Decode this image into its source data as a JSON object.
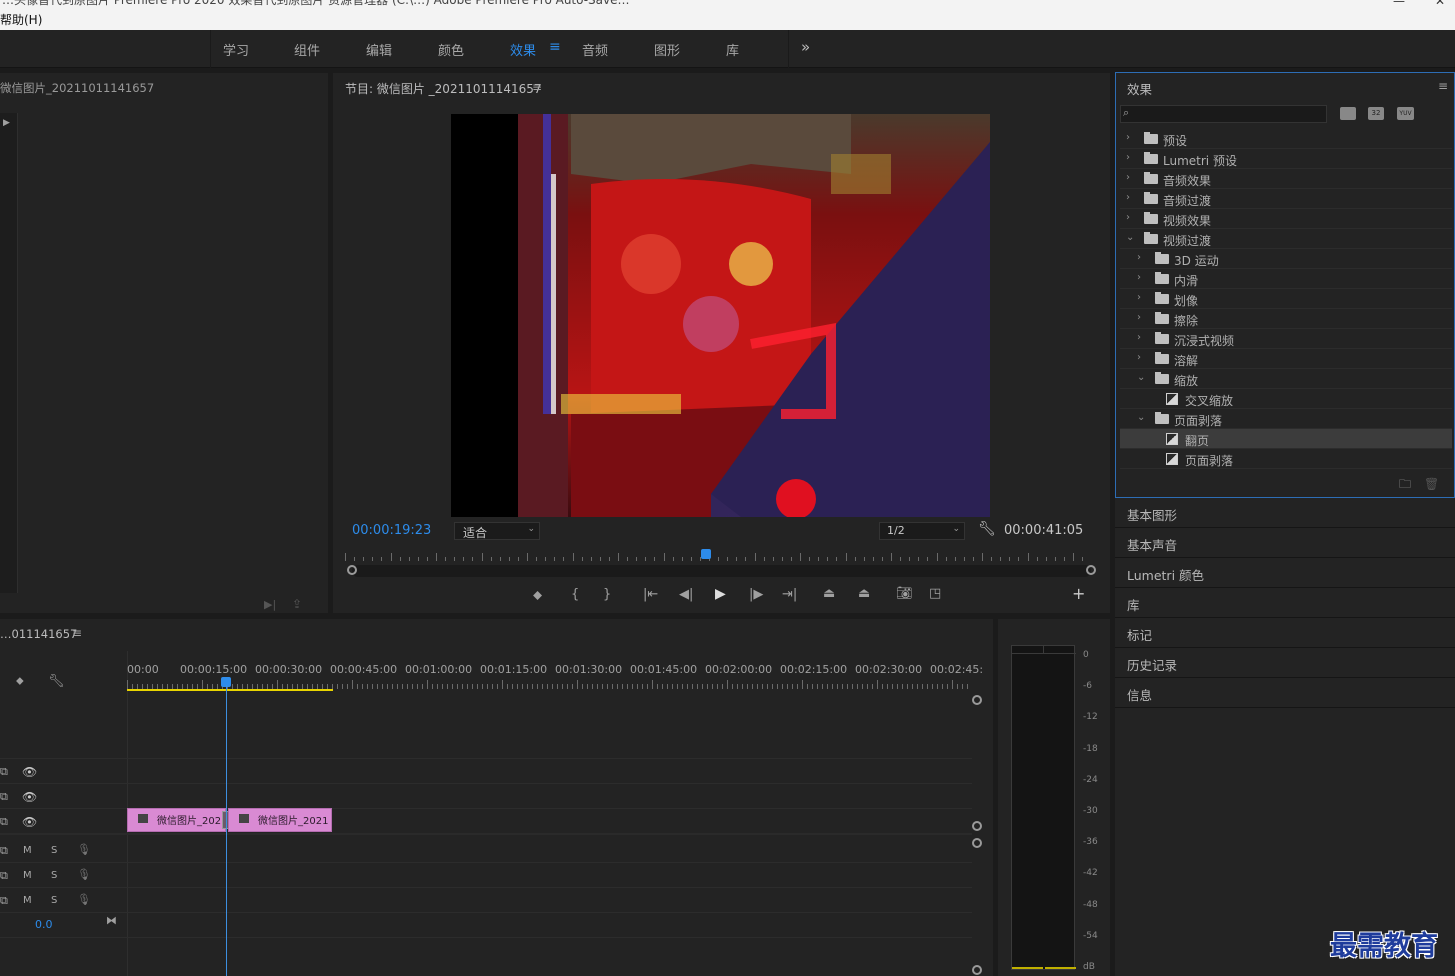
{
  "window": {
    "title": "…头像替代到原图片 Premiere Pro 2020 效果替代到原图片 资源管理器 (C:\\…) Adobe Premiere Pro Auto-Save…",
    "menu_help": "帮助(H)"
  },
  "workspaces": [
    {
      "label": "学习"
    },
    {
      "label": "组件"
    },
    {
      "label": "编辑"
    },
    {
      "label": "颜色"
    },
    {
      "label": "效果",
      "active": true
    },
    {
      "label": "音频"
    },
    {
      "label": "图形"
    },
    {
      "label": "库"
    }
  ],
  "source": {
    "title": "微信图片_20211011141657"
  },
  "program": {
    "title": "节目: 微信图片 _20211011141657",
    "timecode": "00:00:19:23",
    "fit": "适合",
    "resolution": "1/2",
    "duration": "00:00:41:05"
  },
  "effects": {
    "title": "效果",
    "search_value": "",
    "filter_icons": [
      "accelerated-effects-icon",
      "32bit-icon",
      "yuv-icon"
    ],
    "rows": [
      {
        "label": "预设",
        "type": "folder-star",
        "level": 0,
        "expanded": false
      },
      {
        "label": "Lumetri 预设",
        "type": "folder-star",
        "level": 0,
        "expanded": false
      },
      {
        "label": "音频效果",
        "type": "folder",
        "level": 0,
        "expanded": false
      },
      {
        "label": "音频过渡",
        "type": "folder",
        "level": 0,
        "expanded": false
      },
      {
        "label": "视频效果",
        "type": "folder",
        "level": 0,
        "expanded": false
      },
      {
        "label": "视频过渡",
        "type": "folder",
        "level": 0,
        "expanded": true
      },
      {
        "label": "3D 运动",
        "type": "folder",
        "level": 1,
        "expanded": false
      },
      {
        "label": "内滑",
        "type": "folder",
        "level": 1,
        "expanded": false
      },
      {
        "label": "划像",
        "type": "folder",
        "level": 1,
        "expanded": false
      },
      {
        "label": "擦除",
        "type": "folder",
        "level": 1,
        "expanded": false
      },
      {
        "label": "沉浸式视频",
        "type": "folder",
        "level": 1,
        "expanded": false
      },
      {
        "label": "溶解",
        "type": "folder",
        "level": 1,
        "expanded": false
      },
      {
        "label": "缩放",
        "type": "folder",
        "level": 1,
        "expanded": true
      },
      {
        "label": "交叉缩放",
        "type": "effect",
        "level": 2
      },
      {
        "label": "页面剥落",
        "type": "folder",
        "level": 1,
        "expanded": true
      },
      {
        "label": "翻页",
        "type": "effect",
        "level": 2,
        "selected": true
      },
      {
        "label": "页面剥落",
        "type": "effect",
        "level": 2
      }
    ]
  },
  "panels": [
    "基本图形",
    "基本声音",
    "Lumetri 颜色",
    "库",
    "标记",
    "历史记录",
    "信息"
  ],
  "timeline": {
    "title": "…011141657",
    "ruler": [
      "00:00",
      "00:00:15:00",
      "00:00:30:00",
      "00:00:45:00",
      "00:01:00:00",
      "00:01:15:00",
      "00:01:30:00",
      "00:01:45:00",
      "00:02:00:00",
      "00:02:15:00",
      "00:02:30:00",
      "00:02:45:"
    ],
    "clips": [
      {
        "label": "微信图片_202"
      },
      {
        "label": "微信图片_2021"
      }
    ],
    "audio_tracks": [
      {
        "m": "M",
        "s": "S"
      },
      {
        "m": "M",
        "s": "S"
      },
      {
        "m": "M",
        "s": "S"
      }
    ],
    "master_volume": "0.0",
    "playhead_fraction": 0.26
  },
  "audio_meter": {
    "scale": [
      "0",
      "-6",
      "-12",
      "-18",
      "-24",
      "-30",
      "-36",
      "-42",
      "-48",
      "-54",
      "dB"
    ]
  },
  "watermark": "最需教育"
}
